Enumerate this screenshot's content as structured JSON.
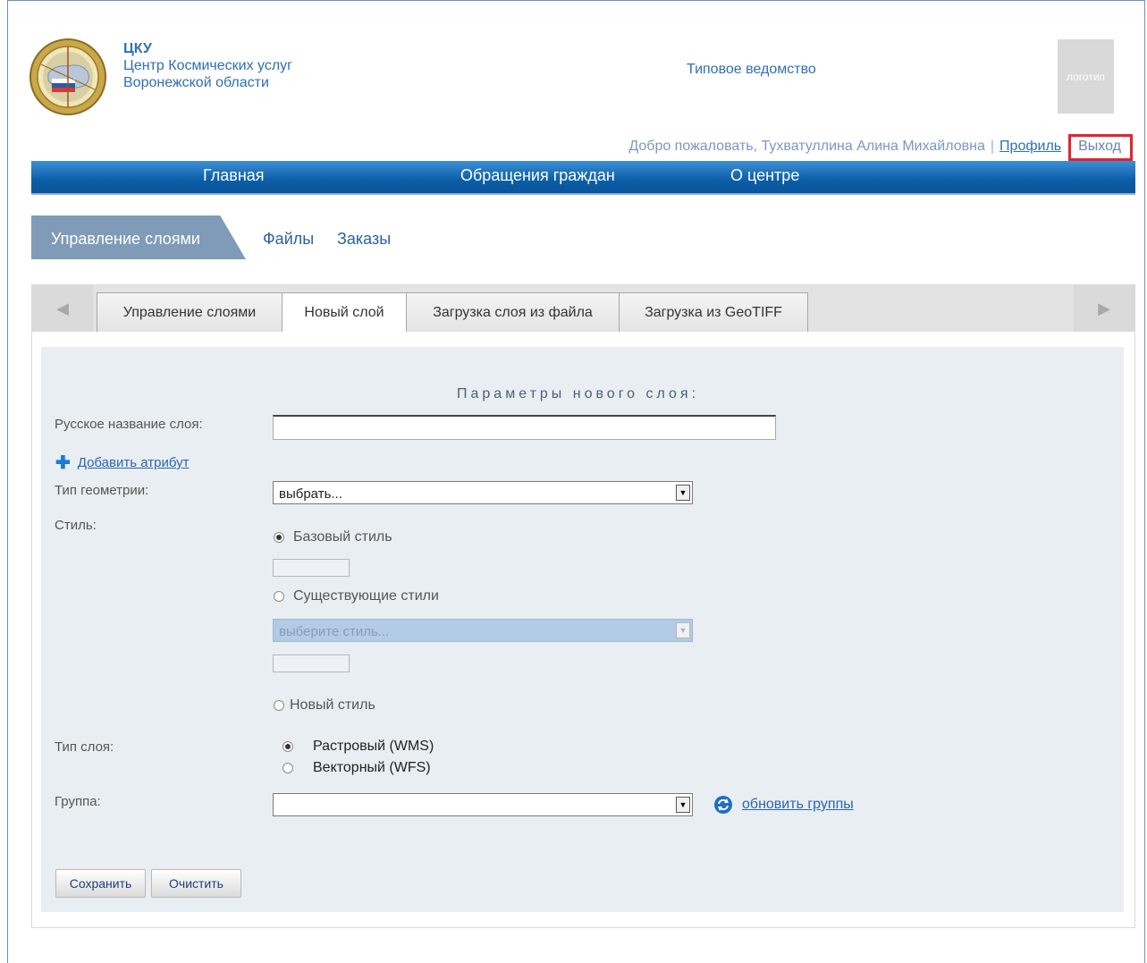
{
  "header": {
    "org_abbr": "ЦКУ",
    "org_line1": "Центр Космических услуг",
    "org_line2": "Воронежской области",
    "agency": "Типовое ведомство",
    "logo_placeholder": "логотип"
  },
  "user": {
    "welcome": "Добро пожаловать, Тухватуллина Алина Михайловна",
    "separator": "|",
    "profile": "Профиль",
    "logout": "Выход"
  },
  "topnav": {
    "items": [
      "Главная",
      "Обращения граждан",
      "О центре"
    ]
  },
  "section_tabs": {
    "active": "Управление слоями",
    "links": [
      "Файлы",
      "Заказы"
    ]
  },
  "tabs": {
    "items": [
      "Управление слоями",
      "Новый слой",
      "Загрузка слоя из файла",
      "Загрузка из GeoTIFF"
    ],
    "active_index": 1
  },
  "form": {
    "heading": "Параметры нового слоя:",
    "name_label": "Русское название слоя:",
    "name_value": "",
    "add_attribute": "Добавить атрибут",
    "geometry_label": "Тип геометрии:",
    "geometry_value": "выбрать...",
    "style_label": "Стиль:",
    "style_options": [
      {
        "label": "Базовый стиль",
        "selected": true
      },
      {
        "label": "Существующие стили",
        "selected": false
      },
      {
        "label": "Новый стиль",
        "selected": false
      }
    ],
    "style_select_placeholder": "выберите стиль...",
    "layer_type_label": "Тип слоя:",
    "layer_types": [
      {
        "label": "Растровый (WMS)",
        "selected": true
      },
      {
        "label": "Векторный (WFS)",
        "selected": false
      }
    ],
    "group_label": "Группа:",
    "group_value": "",
    "refresh_groups": "обновить группы",
    "save": "Сохранить",
    "clear": "Очистить"
  },
  "icons": {
    "nav_left": "triangle-left-icon",
    "nav_right": "triangle-right-icon",
    "plus": "plus-icon",
    "refresh": "refresh-icon",
    "dropdown": "chevron-down-icon"
  },
  "colors": {
    "nav_blue": "#0b5ea6",
    "link_blue": "#2d64b1",
    "highlight_red": "#e3232f",
    "form_bg": "#e9eef2",
    "active_section": "#7f9bb8"
  }
}
